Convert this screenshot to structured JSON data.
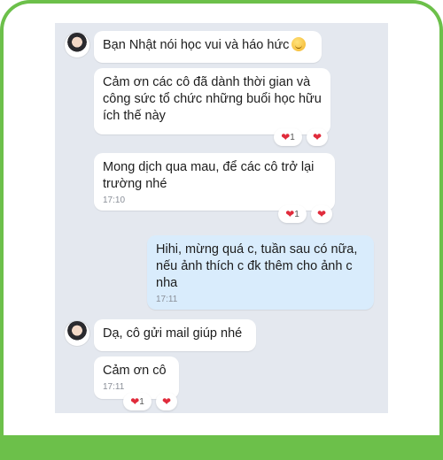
{
  "messages": [
    {
      "text": "Bạn Nhật nói học vui và háo hức",
      "emoji": "smile-emoji"
    },
    {
      "text": "Cảm ơn các cô đã dành thời gian và công sức tổ chức những buổi học hữu ích thế này",
      "reaction_count": "1"
    },
    {
      "text": "Mong dịch qua mau, để các cô trở lại trường nhé",
      "time": "17:10",
      "reaction_count": "1"
    },
    {
      "text": "Hihi, mừng quá c, tuần sau có nữa, nếu ảnh thích c đk thêm cho ảnh c nha",
      "time": "17:11"
    },
    {
      "text": "Dạ, cô gửi mail giúp nhé"
    },
    {
      "text": "Cảm ơn cô",
      "time": "17:11",
      "reaction_count": "1"
    }
  ],
  "colors": {
    "frame_green": "#6cc04a",
    "chat_background": "#e4e8ef",
    "sent_bubble": "#d9ecfc",
    "heart_red": "#e02b3b"
  }
}
